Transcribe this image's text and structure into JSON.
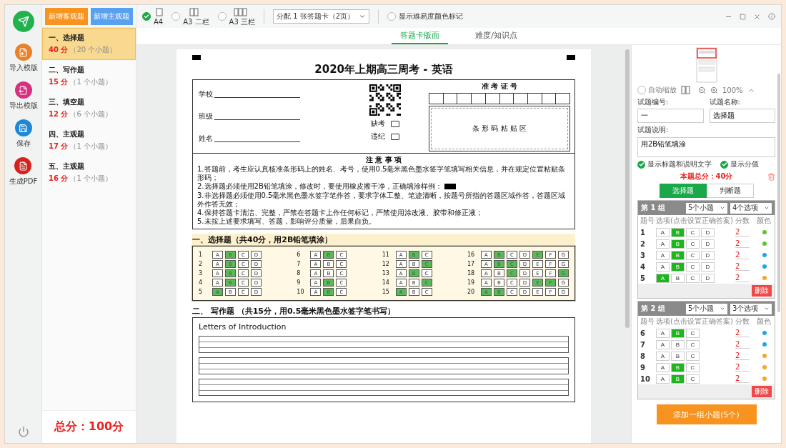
{
  "rail": {
    "items": [
      {
        "kind": "import",
        "label": "导入模版"
      },
      {
        "kind": "export",
        "label": "导出模版"
      },
      {
        "kind": "save",
        "label": "保存"
      },
      {
        "kind": "pdf",
        "label": "生成PDF"
      }
    ]
  },
  "add_buttons": [
    {
      "label": "新增客观题",
      "color": "#f7931e"
    },
    {
      "label": "新增主观题",
      "color": "#5aa0f0"
    }
  ],
  "sections": [
    {
      "title": "一、选择题",
      "score": "40 分",
      "count": "（20 个小题）",
      "selected": true
    },
    {
      "title": "二、写作题",
      "score": "15 分",
      "count": "（1 个小题）",
      "selected": false
    },
    {
      "title": "三、填空题",
      "score": "12 分",
      "count": "（6 个小题）",
      "selected": false
    },
    {
      "title": "四、主观题",
      "score": "17 分",
      "count": "（1 个小题）",
      "selected": false
    },
    {
      "title": "五、主观题",
      "score": "16 分",
      "count": "（1 个小题）",
      "selected": false
    }
  ],
  "total": "总分：100分",
  "toolbar": {
    "layouts": [
      {
        "label": "A4",
        "kind": "single",
        "selected": true
      },
      {
        "label": "A3 二栏",
        "kind": "double",
        "selected": false
      },
      {
        "label": "A3 三栏",
        "kind": "triple",
        "selected": false
      }
    ],
    "dropdown": {
      "value": "分配 1 张答题卡（2页）"
    },
    "color_marks": {
      "label": "显示难易度颜色标记",
      "checked": false
    }
  },
  "tabs": [
    {
      "label": "答题卡版面",
      "selected": true
    },
    {
      "label": "难度/知识点",
      "selected": false
    }
  ],
  "sheet": {
    "title": "2020年上期高三周考 - 英语",
    "fields": [
      "学校",
      "班级",
      "姓名"
    ],
    "marks": [
      "缺考",
      "违纪"
    ],
    "id_label": "准 考 证 号",
    "barcode_label": "条 形 码 粘 贴 区",
    "notes_title": "注 意 事 项",
    "notes": [
      "1.答题前，考生应认真核准条形码上的姓名、考号，使用0.5毫米黑色墨水签字笔填写相关信息，并在规定位置粘贴条形码；",
      "2.选择题必须使用2B铅笔填涂，修改时，要使用橡皮擦干净，正确填涂样例：",
      "3.非选择题必须使用0.5毫米黑色墨水签字笔作答，要求字体工整、笔迹清晰，按题号所指的答题区域作答，答题区域外作答无效；",
      "4.保持答题卡清洁、完整，严禁在答题卡上作任何标记，严禁使用涂改液、胶带和修正液；",
      "5.未按上述要求填写、答题，影响评分质量，后果自负。"
    ],
    "choice_heading": "一、选择题（共40分，用2B铅笔填涂）",
    "columns": [
      [
        {
          "number": "1",
          "options": [
            {
              "label": "A",
              "filled": false
            },
            {
              "label": "B",
              "filled": true
            },
            {
              "label": "C",
              "filled": false
            },
            {
              "label": "D",
              "filled": false
            }
          ]
        },
        {
          "number": "2",
          "options": [
            {
              "label": "A",
              "filled": false
            },
            {
              "label": "B",
              "filled": true
            },
            {
              "label": "C",
              "filled": false
            },
            {
              "label": "D",
              "filled": false
            }
          ]
        },
        {
          "number": "3",
          "options": [
            {
              "label": "A",
              "filled": false
            },
            {
              "label": "B",
              "filled": true
            },
            {
              "label": "C",
              "filled": false
            },
            {
              "label": "D",
              "filled": false
            }
          ]
        },
        {
          "number": "4",
          "options": [
            {
              "label": "A",
              "filled": false
            },
            {
              "label": "B",
              "filled": true
            },
            {
              "label": "C",
              "filled": false
            },
            {
              "label": "D",
              "filled": false
            }
          ]
        },
        {
          "number": "5",
          "options": [
            {
              "label": "A",
              "filled": true
            },
            {
              "label": "B",
              "filled": false
            },
            {
              "label": "C",
              "filled": false
            },
            {
              "label": "D",
              "filled": false
            }
          ]
        }
      ],
      [
        {
          "number": "6",
          "options": [
            {
              "label": "A",
              "filled": false
            },
            {
              "label": "B",
              "filled": true
            },
            {
              "label": "C",
              "filled": false
            }
          ]
        },
        {
          "number": "7",
          "options": [
            {
              "label": "A",
              "filled": false
            },
            {
              "label": "B",
              "filled": false
            },
            {
              "label": "C",
              "filled": false
            }
          ]
        },
        {
          "number": "8",
          "options": [
            {
              "label": "A",
              "filled": false
            },
            {
              "label": "B",
              "filled": false
            },
            {
              "label": "C",
              "filled": false
            }
          ]
        },
        {
          "number": "9",
          "options": [
            {
              "label": "A",
              "filled": false
            },
            {
              "label": "B",
              "filled": true
            },
            {
              "label": "C",
              "filled": false
            }
          ]
        },
        {
          "number": "10",
          "options": [
            {
              "label": "A",
              "filled": false
            },
            {
              "label": "B",
              "filled": true
            },
            {
              "label": "C",
              "filled": false
            }
          ]
        }
      ],
      [
        {
          "number": "11",
          "options": [
            {
              "label": "A",
              "filled": false
            },
            {
              "label": "B",
              "filled": true
            },
            {
              "label": "C",
              "filled": false
            }
          ]
        },
        {
          "number": "12",
          "options": [
            {
              "label": "A",
              "filled": false
            },
            {
              "label": "B",
              "filled": false
            },
            {
              "label": "C",
              "filled": true
            }
          ]
        },
        {
          "number": "13",
          "options": [
            {
              "label": "A",
              "filled": false
            },
            {
              "label": "B",
              "filled": true
            },
            {
              "label": "C",
              "filled": false
            }
          ]
        },
        {
          "number": "14",
          "options": [
            {
              "label": "A",
              "filled": false
            },
            {
              "label": "B",
              "filled": false
            },
            {
              "label": "C",
              "filled": true
            }
          ]
        },
        {
          "number": "15",
          "options": [
            {
              "label": "A",
              "filled": true
            },
            {
              "label": "B",
              "filled": false
            },
            {
              "label": "C",
              "filled": false
            }
          ]
        }
      ],
      [
        {
          "number": "16",
          "options": [
            {
              "label": "A",
              "filled": false
            },
            {
              "label": "B",
              "filled": true
            },
            {
              "label": "C",
              "filled": false
            },
            {
              "label": "D",
              "filled": false
            },
            {
              "label": "E",
              "filled": true
            },
            {
              "label": "F",
              "filled": false
            },
            {
              "label": "G",
              "filled": false
            }
          ]
        },
        {
          "number": "17",
          "options": [
            {
              "label": "A",
              "filled": false
            },
            {
              "label": "B",
              "filled": true
            },
            {
              "label": "C",
              "filled": true
            },
            {
              "label": "D",
              "filled": false
            },
            {
              "label": "E",
              "filled": false
            },
            {
              "label": "F",
              "filled": false
            },
            {
              "label": "G",
              "filled": false
            }
          ]
        },
        {
          "number": "18",
          "options": [
            {
              "label": "A",
              "filled": false
            },
            {
              "label": "B",
              "filled": false
            },
            {
              "label": "C",
              "filled": true
            },
            {
              "label": "D",
              "filled": false
            },
            {
              "label": "E",
              "filled": false
            },
            {
              "label": "F",
              "filled": false
            },
            {
              "label": "G",
              "filled": true
            }
          ]
        },
        {
          "number": "19",
          "options": [
            {
              "label": "A",
              "filled": false
            },
            {
              "label": "B",
              "filled": false
            },
            {
              "label": "C",
              "filled": false
            },
            {
              "label": "D",
              "filled": false
            },
            {
              "label": "E",
              "filled": true
            },
            {
              "label": "F",
              "filled": true
            },
            {
              "label": "G",
              "filled": false
            }
          ]
        },
        {
          "number": "20",
          "options": [
            {
              "label": "A",
              "filled": true
            },
            {
              "label": "B",
              "filled": true
            },
            {
              "label": "C",
              "filled": false
            },
            {
              "label": "D",
              "filled": false
            },
            {
              "label": "E",
              "filled": false
            },
            {
              "label": "F",
              "filled": false
            },
            {
              "label": "G",
              "filled": false
            }
          ]
        }
      ]
    ],
    "writing_heading": "二、 写作题 （共15分，用0.5毫米黑色墨水签字笔书写）",
    "writing_prompt": "Letters of Introduction"
  },
  "panel": {
    "auto_zoom": {
      "label": "自动缩放",
      "selected": false
    },
    "zoom": "100%",
    "number_label": "试题编号:",
    "number_value": "一",
    "name_label": "试题名称:",
    "name_value": "选择题",
    "desc_label": "试题说明:",
    "desc_value": "用2B铅笔填涂",
    "options": [
      {
        "label": "显示标题和说明文字",
        "checked": true
      },
      {
        "label": "显示分值",
        "checked": true
      }
    ],
    "total": "本题总分：40分",
    "types": [
      {
        "label": "选择题",
        "selected": true
      },
      {
        "label": "判断题",
        "selected": false
      }
    ],
    "groups": [
      {
        "title": "第 1 组",
        "count": "5个小题",
        "choices": "4个选项",
        "delete": "删除",
        "columns": [
          "题号",
          "选项(点击设置正确答案)",
          "分数",
          "颜色"
        ],
        "rows": [
          {
            "number": "1",
            "score": "2",
            "color": "#5cc726",
            "options": [
              {
                "label": "A",
                "selected": false
              },
              {
                "label": "B",
                "selected": true
              },
              {
                "label": "C",
                "selected": false
              },
              {
                "label": "D",
                "selected": false
              }
            ]
          },
          {
            "number": "2",
            "score": "2",
            "color": "#5cc726",
            "options": [
              {
                "label": "A",
                "selected": false
              },
              {
                "label": "B",
                "selected": true
              },
              {
                "label": "C",
                "selected": false
              },
              {
                "label": "D",
                "selected": false
              }
            ]
          },
          {
            "number": "3",
            "score": "2",
            "color": "#1ea7e8",
            "options": [
              {
                "label": "A",
                "selected": false
              },
              {
                "label": "B",
                "selected": true
              },
              {
                "label": "C",
                "selected": false
              },
              {
                "label": "D",
                "selected": false
              }
            ]
          },
          {
            "number": "4",
            "score": "2",
            "color": "#1ea7e8",
            "options": [
              {
                "label": "A",
                "selected": false
              },
              {
                "label": "B",
                "selected": true
              },
              {
                "label": "C",
                "selected": false
              },
              {
                "label": "D",
                "selected": false
              }
            ]
          },
          {
            "number": "5",
            "score": "2",
            "color": "#f5a623",
            "options": [
              {
                "label": "A",
                "selected": true
              },
              {
                "label": "B",
                "selected": false
              },
              {
                "label": "C",
                "selected": false
              },
              {
                "label": "D",
                "selected": false
              }
            ]
          }
        ]
      },
      {
        "title": "第 2 组",
        "count": "5个小题",
        "choices": "3个选项",
        "delete": "删除",
        "columns": [
          "题号",
          "选项(点击设置正确答案)",
          "分数",
          "颜色"
        ],
        "rows": [
          {
            "number": "6",
            "score": "2",
            "color": "#1ea7e8",
            "options": [
              {
                "label": "A",
                "selected": false
              },
              {
                "label": "B",
                "selected": true
              },
              {
                "label": "C",
                "selected": false
              }
            ]
          },
          {
            "number": "7",
            "score": "2",
            "color": "#1ea7e8",
            "options": [
              {
                "label": "A",
                "selected": false
              },
              {
                "label": "B",
                "selected": false
              },
              {
                "label": "C",
                "selected": false
              }
            ]
          },
          {
            "number": "8",
            "score": "2",
            "color": "#f5a623",
            "options": [
              {
                "label": "A",
                "selected": false
              },
              {
                "label": "B",
                "selected": false
              },
              {
                "label": "C",
                "selected": false
              }
            ]
          },
          {
            "number": "9",
            "score": "2",
            "color": "#f5a623",
            "options": [
              {
                "label": "A",
                "selected": false
              },
              {
                "label": "B",
                "selected": true
              },
              {
                "label": "C",
                "selected": false
              }
            ]
          },
          {
            "number": "10",
            "score": "2",
            "color": "#f5a623",
            "options": [
              {
                "label": "A",
                "selected": false
              },
              {
                "label": "B",
                "selected": true
              },
              {
                "label": "C",
                "selected": false
              }
            ]
          }
        ]
      }
    ],
    "add_button": "添加一组小题(5个)"
  }
}
